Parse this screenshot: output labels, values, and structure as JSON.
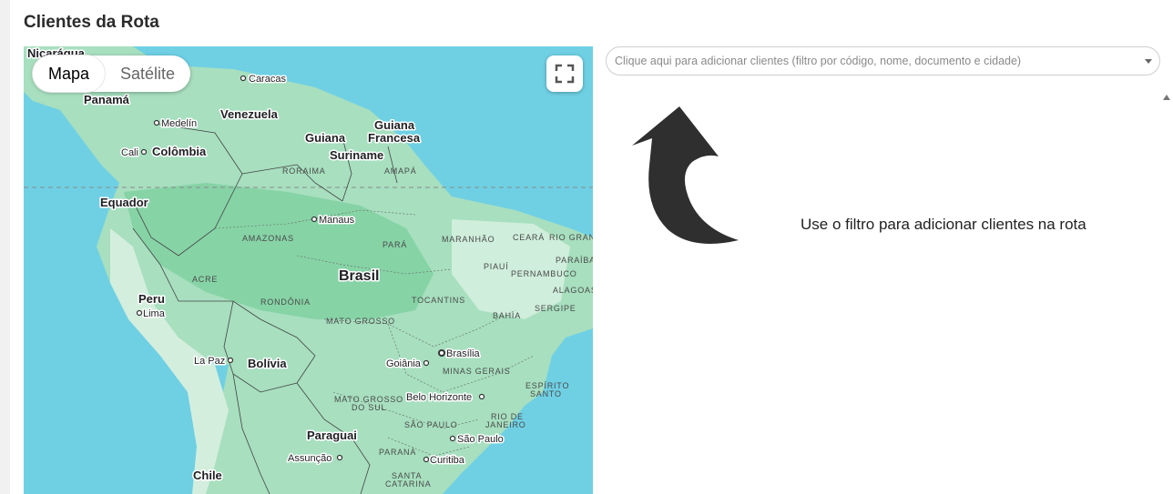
{
  "page": {
    "title": "Clientes da Rota"
  },
  "map": {
    "type_control": {
      "map_label": "Mapa",
      "satellite_label": "Satélite",
      "selected": "Mapa"
    },
    "fullscreen_icon": "fullscreen-icon",
    "countries": {
      "nicaragua": "Nicarágua",
      "panama": "Panamá",
      "venezuela": "Venezuela",
      "guiana": "Guiana",
      "guiana_francesa_1": "Guiana",
      "guiana_francesa_2": "Francesa",
      "suriname": "Suriname",
      "colombia": "Colômbia",
      "equador": "Equador",
      "brasil": "Brasil",
      "peru": "Peru",
      "bolivia": "Bolívia",
      "paraguai": "Paraguai",
      "chile": "Chile"
    },
    "cities": {
      "caracas": "Caracas",
      "medelin": "Medelín",
      "cali": "Cali",
      "manaus": "Manaus",
      "lima": "Lima",
      "la_paz": "La Paz",
      "brasilia": "Brasília",
      "goiania": "Goiânia",
      "belo_horizonte": "Belo Horizonte",
      "sao_paulo": "São Paulo",
      "assuncao": "Assunção",
      "curitiba": "Curitiba"
    },
    "states": {
      "roraima": "RORAIMA",
      "amapa": "AMAPÁ",
      "amazonas": "AMAZONAS",
      "para": "PARÁ",
      "maranhao": "MARANHÃO",
      "ceara": "CEARÁ",
      "rio_grande_do_norte": "RIO GRANDE DO NORTE",
      "paraiba": "PARAÍBA",
      "piaui": "PIAUÍ",
      "pernambuco": "PERNAMBUCO",
      "alagoas": "ALAGOAS",
      "sergipe": "SERGIPE",
      "acre": "ACRE",
      "rondonia": "RONDÔNIA",
      "tocantins": "TOCANTINS",
      "bahia": "BAHIA",
      "mato_grosso": "MATO GROSSO",
      "minas_gerais": "MINAS GERAIS",
      "espirito_santo_1": "ESPÍRITO",
      "espirito_santo_2": "SANTO",
      "mato_grosso_do_sul_1": "MATO GROSSO",
      "mato_grosso_do_sul_2": "DO SUL",
      "sao_paulo": "SÃO PAULO",
      "rio_de_janeiro_1": "RIO DE",
      "rio_de_janeiro_2": "JANEIRO",
      "parana": "PARANÁ",
      "santa_catarina_1": "SANTA",
      "santa_catarina_2": "CATARINA"
    },
    "colors": {
      "water": "#6fd0e4",
      "land": "#a7dfbf",
      "forest": "#86d3a6",
      "dry": "#d4eedd"
    }
  },
  "client_filter": {
    "placeholder": "Clique aqui para adicionar clientes (filtro por código, nome, documento e cidade)",
    "caret_icon": "chevron-down-icon"
  },
  "empty_state": {
    "message": "Use o filtro para adicionar clientes na rota",
    "arrow_icon": "curved-arrow-up-icon"
  }
}
